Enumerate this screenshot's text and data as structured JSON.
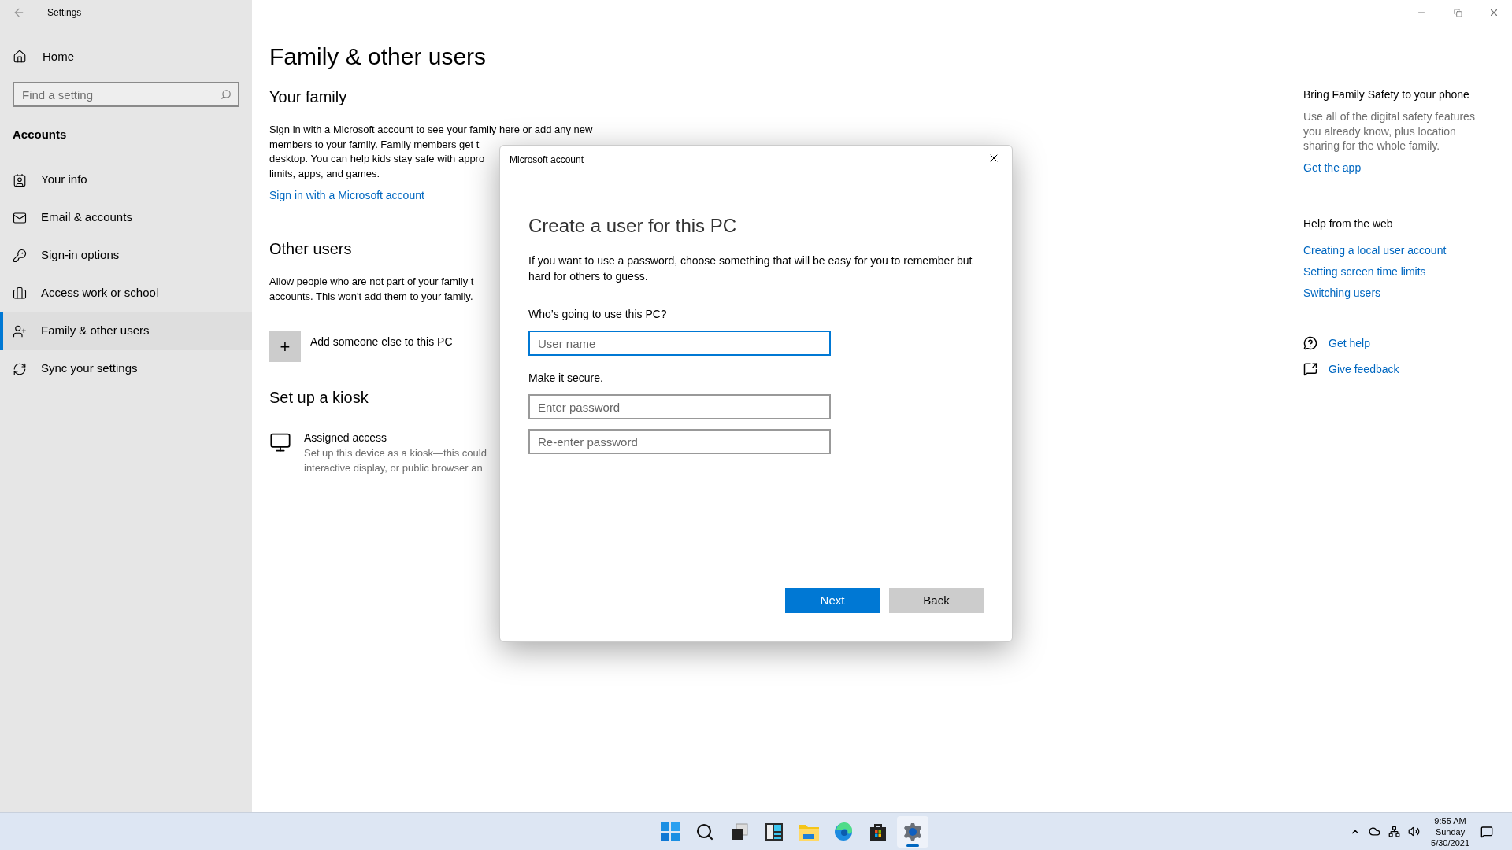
{
  "window": {
    "title": "Settings"
  },
  "sidebar": {
    "home": "Home",
    "search": {
      "placeholder": "Find a setting"
    },
    "section": "Accounts",
    "items": [
      {
        "label": "Your info",
        "selected": false
      },
      {
        "label": "Email & accounts",
        "selected": false
      },
      {
        "label": "Sign-in options",
        "selected": false
      },
      {
        "label": "Access work or school",
        "selected": false
      },
      {
        "label": "Family & other users",
        "selected": true
      },
      {
        "label": "Sync your settings",
        "selected": false
      }
    ]
  },
  "page": {
    "title": "Family & other users",
    "your_family": {
      "heading": "Your family",
      "lines": [
        "Sign in with a Microsoft account to see your family here or add any new",
        "members to your family. Family members get t",
        "desktop. You can help kids stay safe with appro",
        "limits, apps, and games."
      ],
      "link": "Sign in with a Microsoft account"
    },
    "other_users": {
      "heading": "Other users",
      "lines": [
        "Allow people who are not part of your family t",
        "accounts. This won't add them to your family."
      ],
      "add_button": "+",
      "add_label": "Add someone else to this PC"
    },
    "kiosk": {
      "heading": "Set up a kiosk",
      "title": "Assigned access",
      "lines": [
        "Set up this device as a kiosk—this could",
        "interactive display, or public browser an"
      ]
    }
  },
  "related": {
    "family_safety": {
      "heading": "Bring Family Safety to your phone",
      "text": "Use all of the digital safety features you already know, plus location sharing for the whole family.",
      "link": "Get the app"
    },
    "help": {
      "heading": "Help from the web",
      "links": [
        "Creating a local user account",
        "Setting screen time limits",
        "Switching users"
      ]
    },
    "actions": [
      {
        "label": "Get help"
      },
      {
        "label": "Give feedback"
      }
    ]
  },
  "dialog": {
    "title": "Microsoft account",
    "heading": "Create a user for this PC",
    "text": "If you want to use a password, choose something that will be easy for you to remember but hard for others to guess.",
    "question": "Who’s going to use this PC?",
    "username": {
      "placeholder": "User name",
      "focused": true
    },
    "secure_label": "Make it secure.",
    "password": {
      "placeholder": "Enter password",
      "focused": false
    },
    "reenter": {
      "placeholder": "Re-enter password",
      "focused": false
    },
    "buttons": [
      {
        "label": "Next",
        "kind": "primary"
      },
      {
        "label": "Back",
        "kind": "secondary"
      }
    ]
  },
  "taskbar": {
    "apps": [
      {
        "selected": false
      },
      {
        "selected": false
      },
      {
        "selected": false
      },
      {
        "selected": false
      },
      {
        "selected": false
      },
      {
        "selected": false
      },
      {
        "selected": false
      },
      {
        "selected": true
      }
    ],
    "clock": {
      "time": "9:55 AM",
      "day": "Sunday",
      "date": "5/30/2021"
    }
  }
}
